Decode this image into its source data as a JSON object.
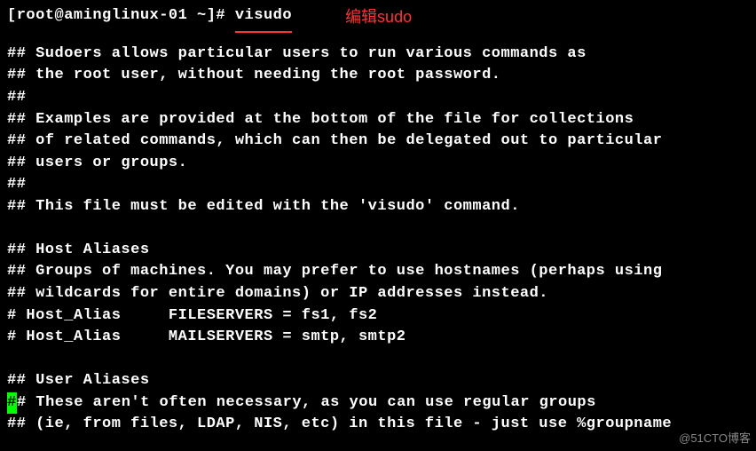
{
  "prompt": {
    "text": "[root@aminglinux-01 ~]# ",
    "command": "visudo",
    "annotation": "编辑sudo"
  },
  "lines": [
    "## Sudoers allows particular users to run various commands as",
    "## the root user, without needing the root password.",
    "##",
    "## Examples are provided at the bottom of the file for collections",
    "## of related commands, which can then be delegated out to particular",
    "## users or groups.",
    "##",
    "## This file must be edited with the 'visudo' command.",
    "",
    "## Host Aliases",
    "## Groups of machines. You may prefer to use hostnames (perhaps using",
    "## wildcards for entire domains) or IP addresses instead.",
    "# Host_Alias     FILESERVERS = fs1, fs2",
    "# Host_Alias     MAILSERVERS = smtp, smtp2",
    "",
    "## User Aliases"
  ],
  "cursor_line_after": "# These aren't often necessary, as you can use regular groups",
  "last_line": "## (ie, from files, LDAP, NIS, etc) in this file - just use %groupname",
  "cursor_char": "#",
  "watermark": "@51CTO博客"
}
